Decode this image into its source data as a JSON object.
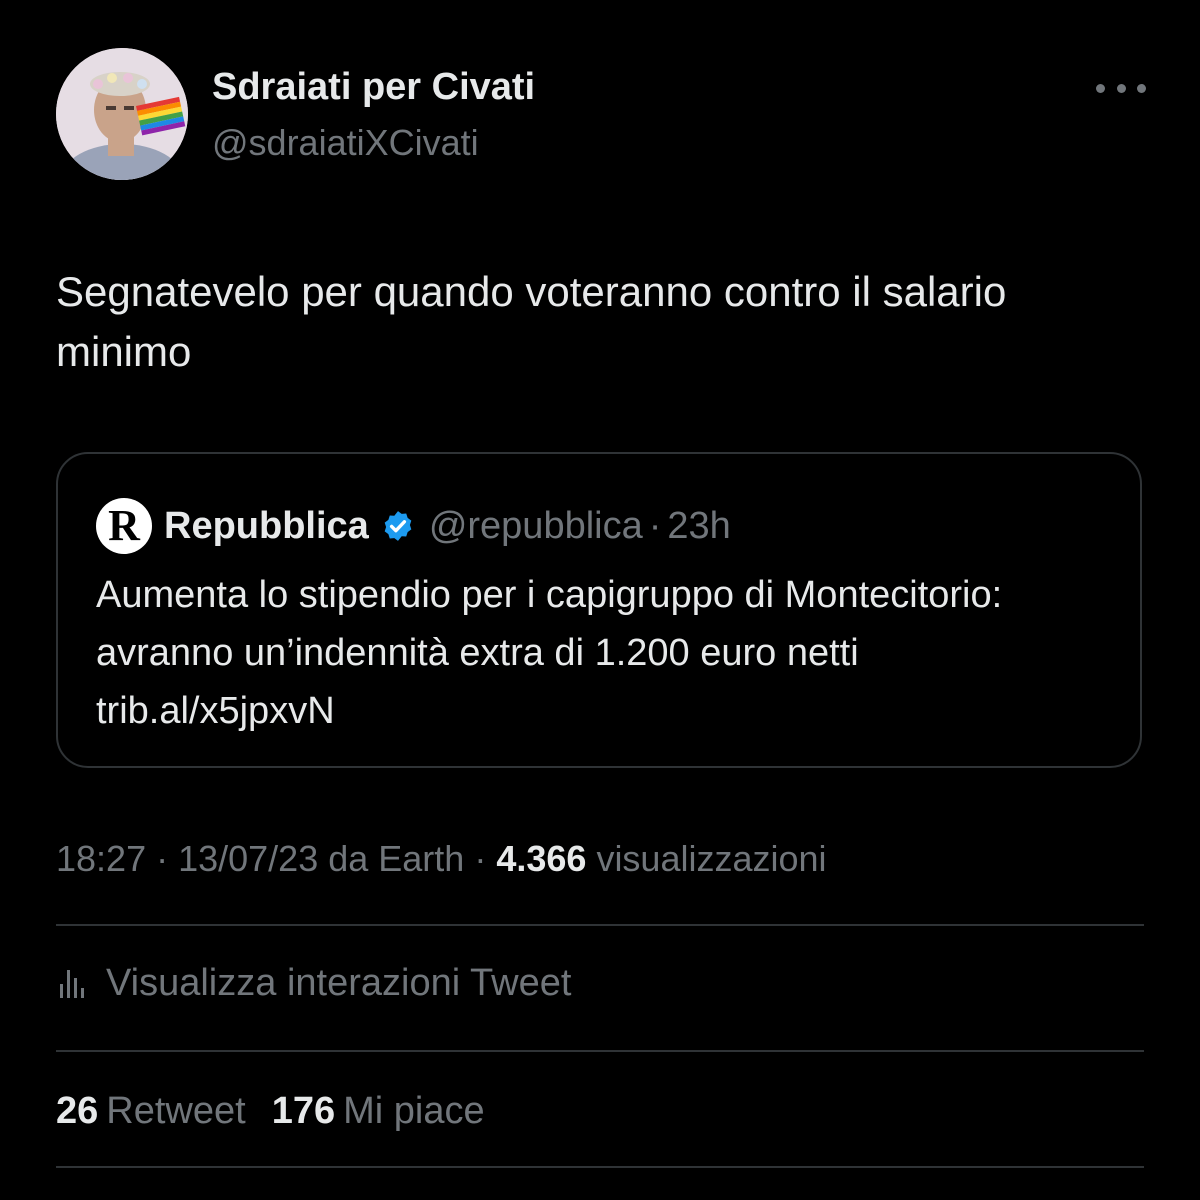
{
  "author": {
    "name": "Sdraiati per Civati",
    "handle": "@sdraiatiXCivati",
    "avatar_icon": "avatar-photo-with-rainbow-flag"
  },
  "more_icon": "more-dots-icon",
  "tweet": {
    "text": "Segnatevelo per quando voteranno contro il salario minimo"
  },
  "quote": {
    "logo_letter": "R",
    "name": "Repubblica",
    "verified_icon": "verified-badge-icon",
    "handle": "@repubblica",
    "separator": "·",
    "time": "23h",
    "text": "Aumenta lo stipendio per i capigruppo di Montecitorio: avranno un’indennità extra di 1.200 euro netti trib.al/x5jpxvN"
  },
  "meta": {
    "time": "18:27",
    "separator": " · ",
    "date_source": "13/07/23 da Earth",
    "views_count": "4.366",
    "views_label": "visualizzazioni"
  },
  "interactions": {
    "icon": "analytics-bars-icon",
    "label": "Visualizza interazioni Tweet"
  },
  "stats": {
    "retweets_count": "26",
    "retweets_label": "Retweet",
    "likes_count": "176",
    "likes_label": "Mi piace"
  },
  "colors": {
    "background": "#000000",
    "text_primary": "#e7e9ea",
    "text_secondary": "#71767b",
    "border": "#2f3336",
    "verified": "#1d9bf0"
  }
}
